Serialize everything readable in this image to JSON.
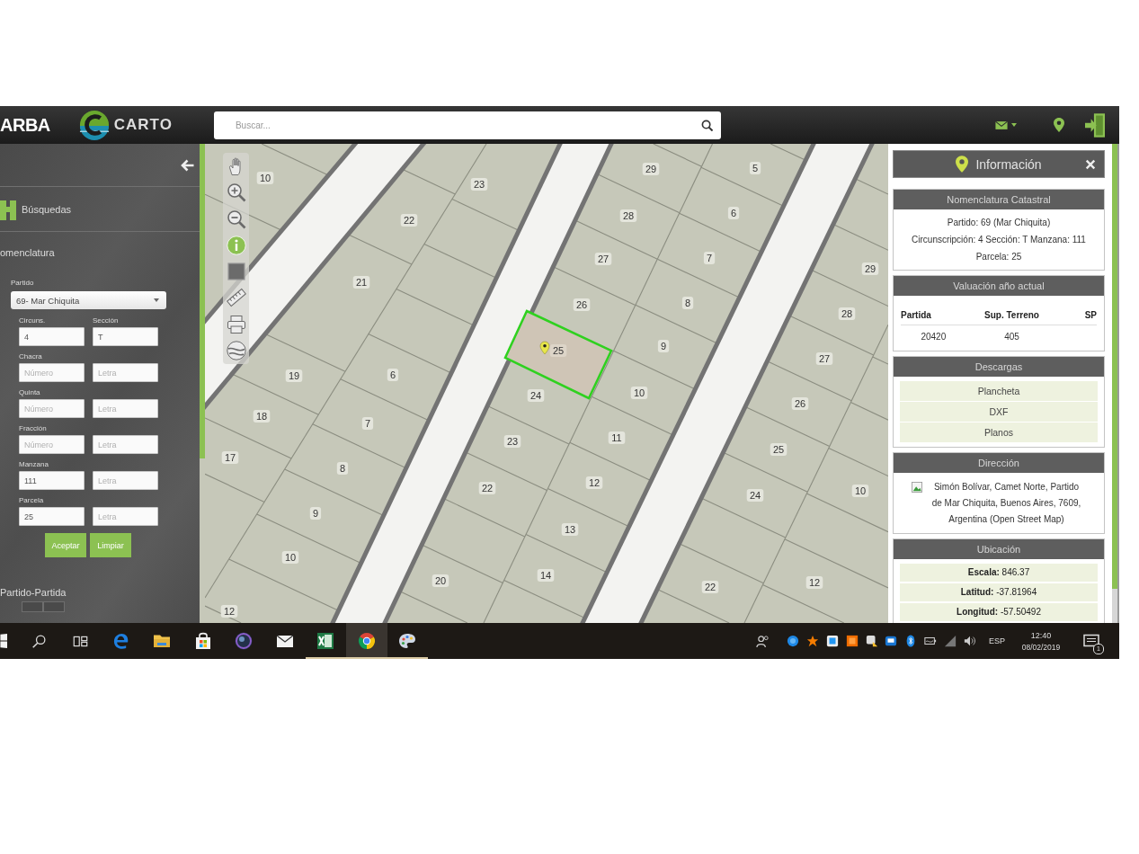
{
  "header": {
    "logo": "ARBA",
    "app_name": "CARTO",
    "search": {
      "placeholder": "Buscar..."
    }
  },
  "sidebar": {
    "title": "Búsquedas",
    "section": "omenclatura",
    "partido": {
      "label": "Partido",
      "value": "69- Mar Chiquita"
    },
    "rows": [
      {
        "labels": [
          "Circuns.",
          "Sección"
        ],
        "fields": [
          {
            "value": "4"
          },
          {
            "value": "T"
          }
        ]
      },
      {
        "labels": [
          "Chacra"
        ],
        "fields": [
          {
            "placeholder": "Número"
          },
          {
            "placeholder": "Letra"
          }
        ]
      },
      {
        "labels": [
          "Quinta"
        ],
        "fields": [
          {
            "placeholder": "Número"
          },
          {
            "placeholder": "Letra"
          }
        ]
      },
      {
        "labels": [
          "Fracción"
        ],
        "fields": [
          {
            "placeholder": "Número"
          },
          {
            "placeholder": "Letra"
          }
        ]
      },
      {
        "labels": [
          "Manzana"
        ],
        "fields": [
          {
            "value": "111"
          },
          {
            "placeholder": "Letra"
          }
        ]
      },
      {
        "labels": [
          "Parcela"
        ],
        "fields": [
          {
            "value": "25"
          },
          {
            "placeholder": "Letra"
          }
        ]
      }
    ],
    "buttons": [
      "Aceptar",
      "Limpiar"
    ],
    "next_section": "Partido-Partida"
  },
  "map": {
    "tools": [
      {
        "kind": "pan",
        "selected": false
      },
      {
        "kind": "zoom_in",
        "selected": false
      },
      {
        "kind": "zoom_out",
        "selected": false
      },
      {
        "kind": "info",
        "selected": true
      },
      {
        "kind": "box",
        "selected": false
      },
      {
        "kind": "measure",
        "selected": false
      },
      {
        "kind": "print",
        "selected": false
      },
      {
        "kind": "layers",
        "selected": false
      }
    ],
    "parcels": [
      {
        "label": "29",
        "selected": false
      },
      {
        "label": "5",
        "selected": false
      },
      {
        "label": "10",
        "selected": false
      },
      {
        "label": "23",
        "selected": false
      },
      {
        "label": "22",
        "selected": false
      },
      {
        "label": "28",
        "selected": false
      },
      {
        "label": "6",
        "selected": false
      },
      {
        "label": "27",
        "selected": false
      },
      {
        "label": "7",
        "selected": false
      },
      {
        "label": "29",
        "selected": false
      },
      {
        "label": "21",
        "selected": false
      },
      {
        "label": "26",
        "selected": false
      },
      {
        "label": "8",
        "selected": false
      },
      {
        "label": "28",
        "selected": false
      },
      {
        "label": "25",
        "selected": true
      },
      {
        "label": "9",
        "selected": false
      },
      {
        "label": "27",
        "selected": false
      },
      {
        "label": "19",
        "selected": false
      },
      {
        "label": "6",
        "selected": false
      },
      {
        "label": "24",
        "selected": false
      },
      {
        "label": "10",
        "selected": false
      },
      {
        "label": "26",
        "selected": false
      },
      {
        "label": "18",
        "selected": false
      },
      {
        "label": "7",
        "selected": false
      },
      {
        "label": "23",
        "selected": false
      },
      {
        "label": "11",
        "selected": false
      },
      {
        "label": "25",
        "selected": false
      },
      {
        "label": "17",
        "selected": false
      },
      {
        "label": "8",
        "selected": false
      },
      {
        "label": "22",
        "selected": false
      },
      {
        "label": "12",
        "selected": false
      },
      {
        "label": "10",
        "selected": false
      },
      {
        "label": "24",
        "selected": false
      },
      {
        "label": "9",
        "selected": false
      },
      {
        "label": "13",
        "selected": false
      },
      {
        "label": "10",
        "selected": false
      },
      {
        "label": "20",
        "selected": false
      },
      {
        "label": "14",
        "selected": false
      },
      {
        "label": "22",
        "selected": false
      },
      {
        "label": "12",
        "selected": false
      },
      {
        "label": "12",
        "selected": false
      }
    ]
  },
  "info_panel": {
    "title": "Información",
    "sections": [
      {
        "kind": "lines",
        "title": "Nomenclatura Catastral",
        "lines": [
          "Partido: 69 (Mar Chiquita)",
          "Circunscripción: 4 Sección: T Manzana: 111",
          "Parcela: 25"
        ]
      },
      {
        "kind": "table",
        "title": "Valuación año actual",
        "columns": [
          "Partida",
          "Sup. Terreno",
          "SP"
        ],
        "rows": [
          [
            "20420",
            "405"
          ]
        ]
      },
      {
        "kind": "links",
        "title": "Descargas",
        "items": [
          "Plancheta",
          "DXF",
          "Planos"
        ]
      },
      {
        "kind": "address",
        "title": "Dirección",
        "text": "Simón Bolívar, Camet Norte, Partido de Mar Chiquita, Buenos Aires, 7609, Argentina (Open Street Map)"
      },
      {
        "kind": "fields",
        "title": "Ubicación",
        "items": [
          "**Escala:** 846.37",
          "**Latitud:** -37.81964",
          "**Longitud:** -57.50492"
        ]
      }
    ]
  },
  "taskbar": {
    "apps": [
      {
        "kind": "start",
        "open": false,
        "active": false
      },
      {
        "kind": "search",
        "open": false,
        "active": false
      },
      {
        "kind": "task_view",
        "open": false,
        "active": false
      },
      {
        "kind": "swirl",
        "open": false,
        "active": false
      },
      {
        "kind": "folder",
        "open": false,
        "active": false
      },
      {
        "kind": "bag",
        "open": false,
        "active": false
      },
      {
        "kind": "ring",
        "open": false,
        "active": false
      },
      {
        "kind": "mail",
        "open": false,
        "active": false
      },
      {
        "kind": "sheet",
        "open": true,
        "active": false
      },
      {
        "kind": "wheel",
        "open": true,
        "active": true
      },
      {
        "kind": "palette",
        "open": true,
        "active": false
      }
    ],
    "language": "ESP",
    "time": "12:40",
    "date": "08/02/2019",
    "notifications": "1"
  }
}
